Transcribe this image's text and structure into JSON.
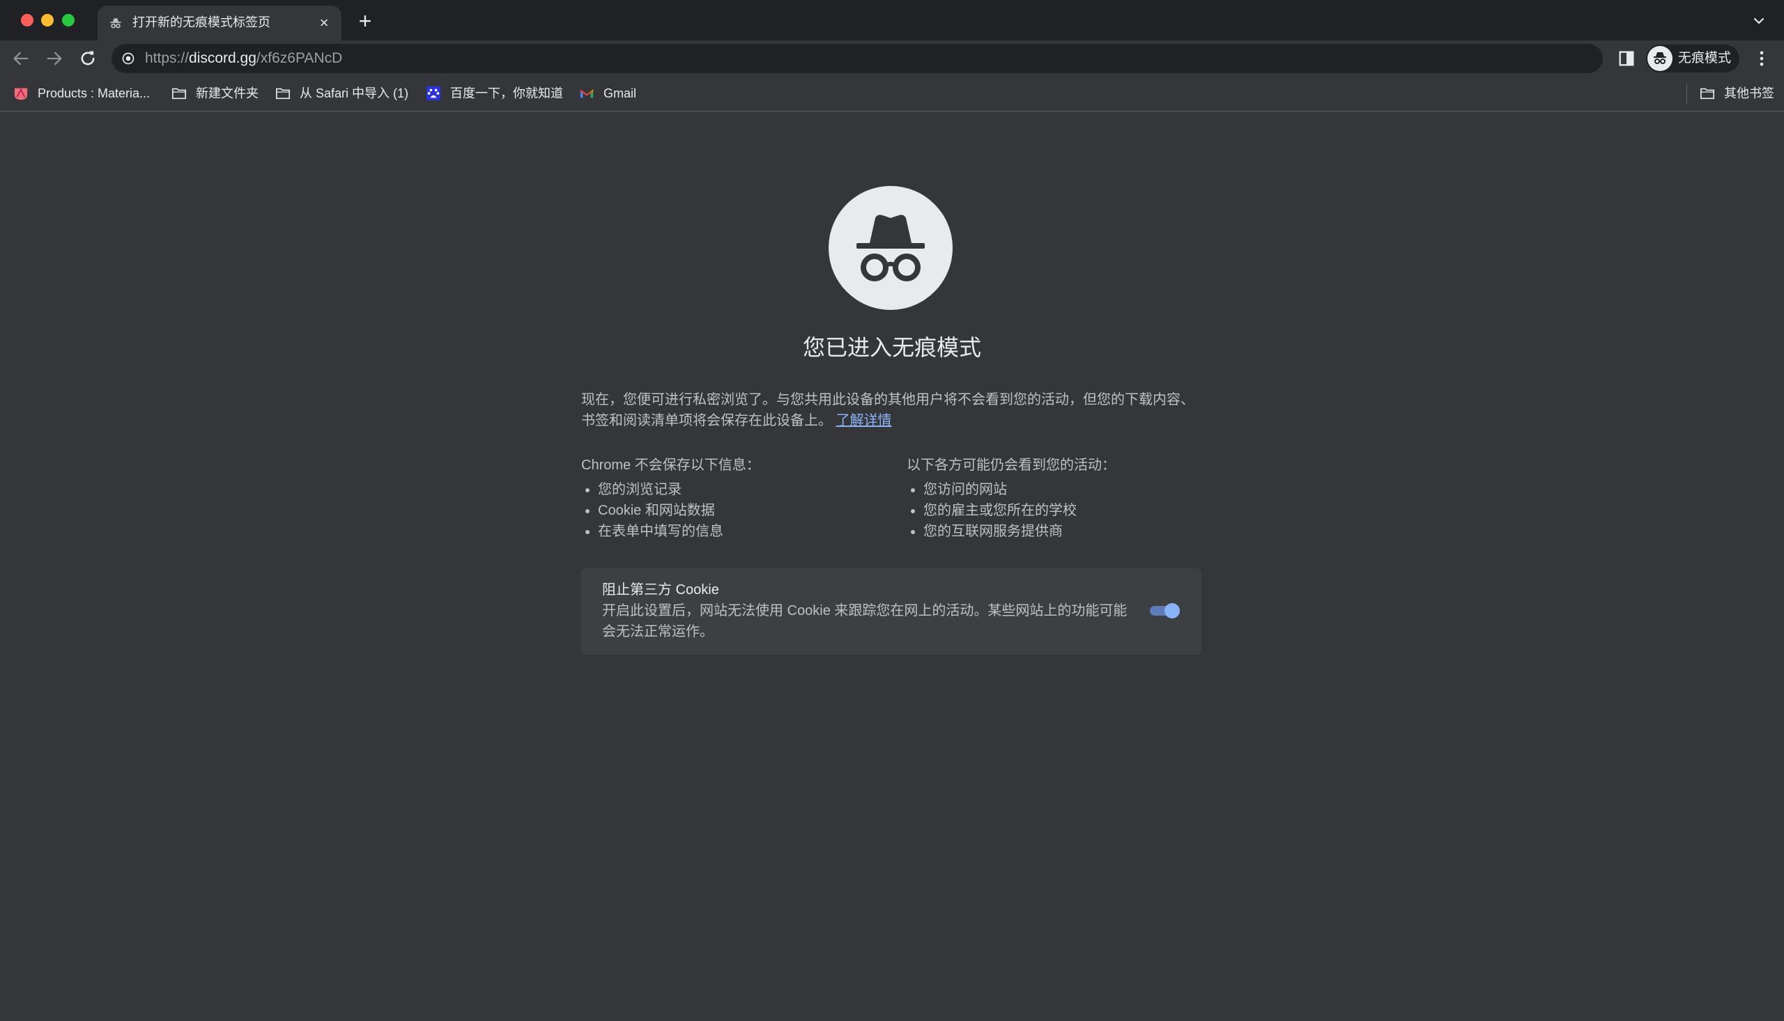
{
  "tab": {
    "title": "打开新的无痕模式标签页",
    "close_label": "×"
  },
  "new_tab_label": "+",
  "omnibox": {
    "url_scheme": "https://",
    "url_host": "discord.gg",
    "url_path": "/xf6z6PANcD"
  },
  "profile": {
    "label": "无痕模式"
  },
  "bookmarks": {
    "items": [
      {
        "label": "Products : Materia...",
        "icon": "materialize-favicon-icon"
      },
      {
        "label": "新建文件夹",
        "icon": "folder-icon"
      },
      {
        "label": "从 Safari 中导入 (1)",
        "icon": "folder-icon"
      },
      {
        "label": "百度一下，你就知道",
        "icon": "baidu-favicon-icon"
      },
      {
        "label": "Gmail",
        "icon": "gmail-favicon-icon"
      }
    ],
    "other_label": "其他书签"
  },
  "incognito_page": {
    "heading": "您已进入无痕模式",
    "intro": "现在，您便可进行私密浏览了。与您共用此设备的其他用户将不会看到您的活动，但您的下载内容、书签和阅读清单项将会保存在此设备上。",
    "learn_more": "了解详情",
    "not_saved": {
      "title": "Chrome 不会保存以下信息：",
      "items": [
        "您的浏览记录",
        "Cookie 和网站数据",
        "在表单中填写的信息"
      ]
    },
    "may_see": {
      "title": "以下各方可能仍会看到您的活动：",
      "items": [
        "您访问的网站",
        "您的雇主或您所在的学校",
        "您的互联网服务提供商"
      ]
    },
    "cookie_card": {
      "title": "阻止第三方 Cookie",
      "description": "开启此设置后，网站无法使用 Cookie 来跟踪您在网上的活动。某些网站上的功能可能会无法正常运作。",
      "enabled": true
    }
  },
  "colors": {
    "tabstrip_bg": "#202124",
    "page_bg": "#35363a",
    "link": "#8ab4f8",
    "toggle_on": "#8ab4f8"
  }
}
